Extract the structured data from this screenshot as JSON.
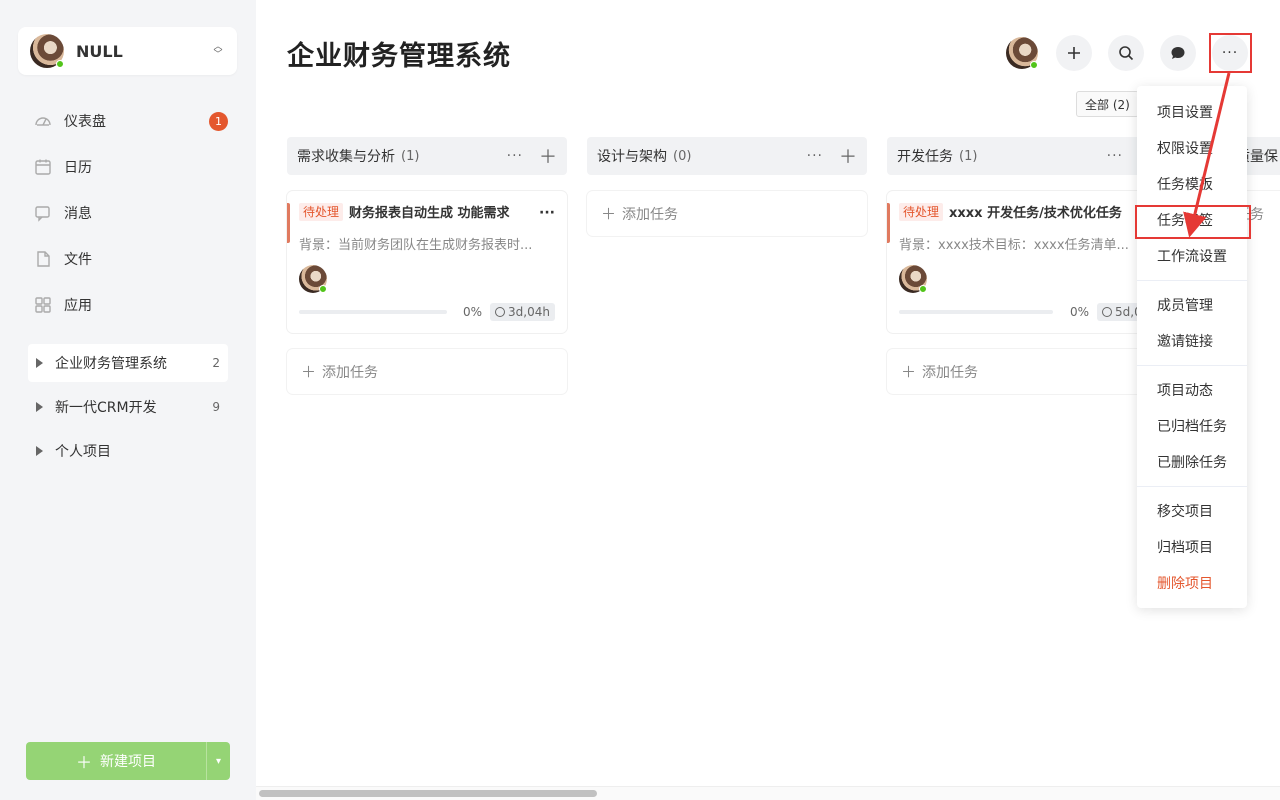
{
  "user": {
    "name": "NULL"
  },
  "nav": {
    "items": [
      {
        "label": "仪表盘",
        "icon": "dashboard-icon",
        "badge": "1"
      },
      {
        "label": "日历",
        "icon": "calendar-icon"
      },
      {
        "label": "消息",
        "icon": "message-icon"
      },
      {
        "label": "文件",
        "icon": "file-icon"
      },
      {
        "label": "应用",
        "icon": "apps-icon"
      }
    ]
  },
  "projects": [
    {
      "label": "企业财务管理系统",
      "count": "2",
      "active": true
    },
    {
      "label": "新一代CRM开发",
      "count": "9"
    },
    {
      "label": "个人项目",
      "count": ""
    }
  ],
  "new_project_label": "新建项目",
  "page_title": "企业财务管理系统",
  "filter_chip": "全部 (2)",
  "columns": [
    {
      "title": "需求收集与分析",
      "count": "(1)",
      "card": {
        "tag": "待处理",
        "title": "财务报表自动生成  功能需求",
        "desc": "背景：当前财务团队在生成财务报表时...",
        "progress": "0%",
        "duration": "3d,04h"
      },
      "add_task": "添加任务"
    },
    {
      "title": "设计与架构",
      "count": "(0)",
      "add_task": "添加任务"
    },
    {
      "title": "开发任务",
      "count": "(1)",
      "card": {
        "tag": "待处理",
        "title": "xxxx  开发任务/技术优化任务",
        "desc": "背景：xxxx技术目标：xxxx任务清单...",
        "progress": "0%",
        "duration": "5d,0"
      },
      "add_task": "添加任务"
    },
    {
      "title": "质量保",
      "add_task": "任务"
    }
  ],
  "menu": {
    "groups": [
      [
        "项目设置",
        "权限设置",
        "任务模板",
        "任务标签",
        "工作流设置"
      ],
      [
        "成员管理",
        "邀请链接"
      ],
      [
        "项目动态",
        "已归档任务",
        "已删除任务"
      ],
      [
        "移交项目",
        "归档项目",
        "删除项目"
      ]
    ]
  },
  "colors": {
    "accent_green": "#95d475",
    "danger": "#e4572e",
    "annotation_red": "#e53935"
  }
}
